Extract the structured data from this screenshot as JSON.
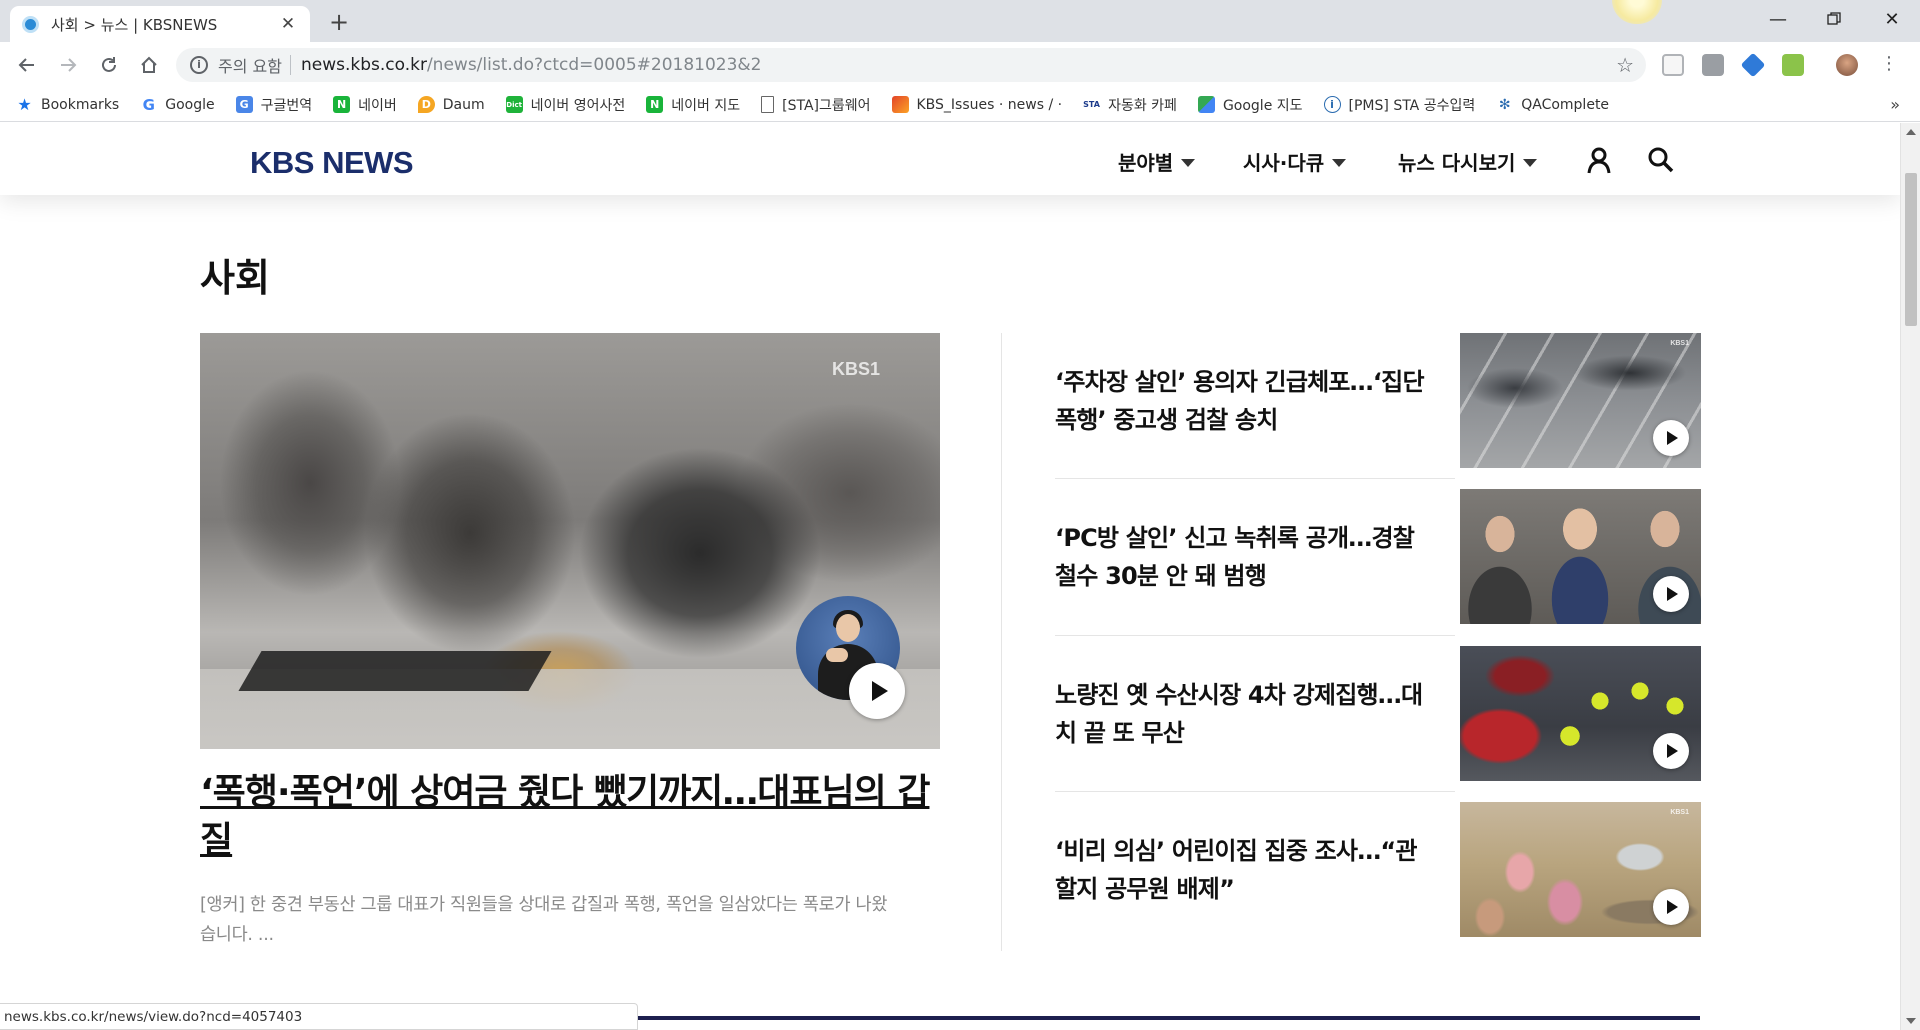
{
  "browser": {
    "tab_title": "사회 > 뉴스 | KBSNEWS",
    "security_label": "주의 요함",
    "url_host": "news.kbs.co.kr",
    "url_path": "/news/list.do?ctcd=0005#20181023&2",
    "bookmarks": [
      {
        "label": "Bookmarks",
        "icon": "star-icon"
      },
      {
        "label": "Google",
        "icon": "google-icon"
      },
      {
        "label": "구글번역",
        "icon": "translate-icon"
      },
      {
        "label": "네이버",
        "icon": "naver-icon"
      },
      {
        "label": "Daum",
        "icon": "daum-icon"
      },
      {
        "label": "네이버 영어사전",
        "icon": "dict-icon"
      },
      {
        "label": "네이버 지도",
        "icon": "naver-icon"
      },
      {
        "label": "[STA]그룹웨어",
        "icon": "page-icon"
      },
      {
        "label": "KBS_Issues · news / ·",
        "icon": "gitlab-icon"
      },
      {
        "label": "자동화 카페",
        "icon": "sta-icon"
      },
      {
        "label": "Google 지도",
        "icon": "maps-icon"
      },
      {
        "label": "[PMS] STA 공수입력",
        "icon": "pms-icon"
      },
      {
        "label": "QAComplete",
        "icon": "qa-icon"
      }
    ],
    "bookmarks_more": "»",
    "status_url": "news.kbs.co.kr/news/view.do?ncd=4057403"
  },
  "site": {
    "logo": "KBS NEWS",
    "nav": [
      {
        "label": "분야별"
      },
      {
        "label": "시사·다큐"
      },
      {
        "label": "뉴스 다시보기"
      }
    ],
    "section_title": "사회",
    "brand_color": "#1b2e6b"
  },
  "main_article": {
    "watermark": "KBS1",
    "headline": "‘폭행·폭언’에 상여금 줬다 뺐기까지…대표님의 갑질",
    "summary": "[앵커] 한 중견 부동산 그룹 대표가 직원들을 상대로 갑질과 폭행, 폭언을 일삼았다는 폭로가 나왔습니다. ..."
  },
  "side_articles": [
    {
      "headline": "‘주차장 살인’ 용의자 긴급체포…‘집단 폭행’ 중고생 검찰 송치",
      "watermark": "KBS1"
    },
    {
      "headline": "‘PC방 살인’ 신고 녹취록 공개…경찰 철수 30분 안 돼 범행",
      "watermark": ""
    },
    {
      "headline": "노량진 옛 수산시장 4차 강제집행…대치 끝 또 무산",
      "watermark": ""
    },
    {
      "headline": "‘비리 의심’ 어린이집 집중 조사…“관할지 공무원 배제”",
      "watermark": "KBS1"
    }
  ]
}
